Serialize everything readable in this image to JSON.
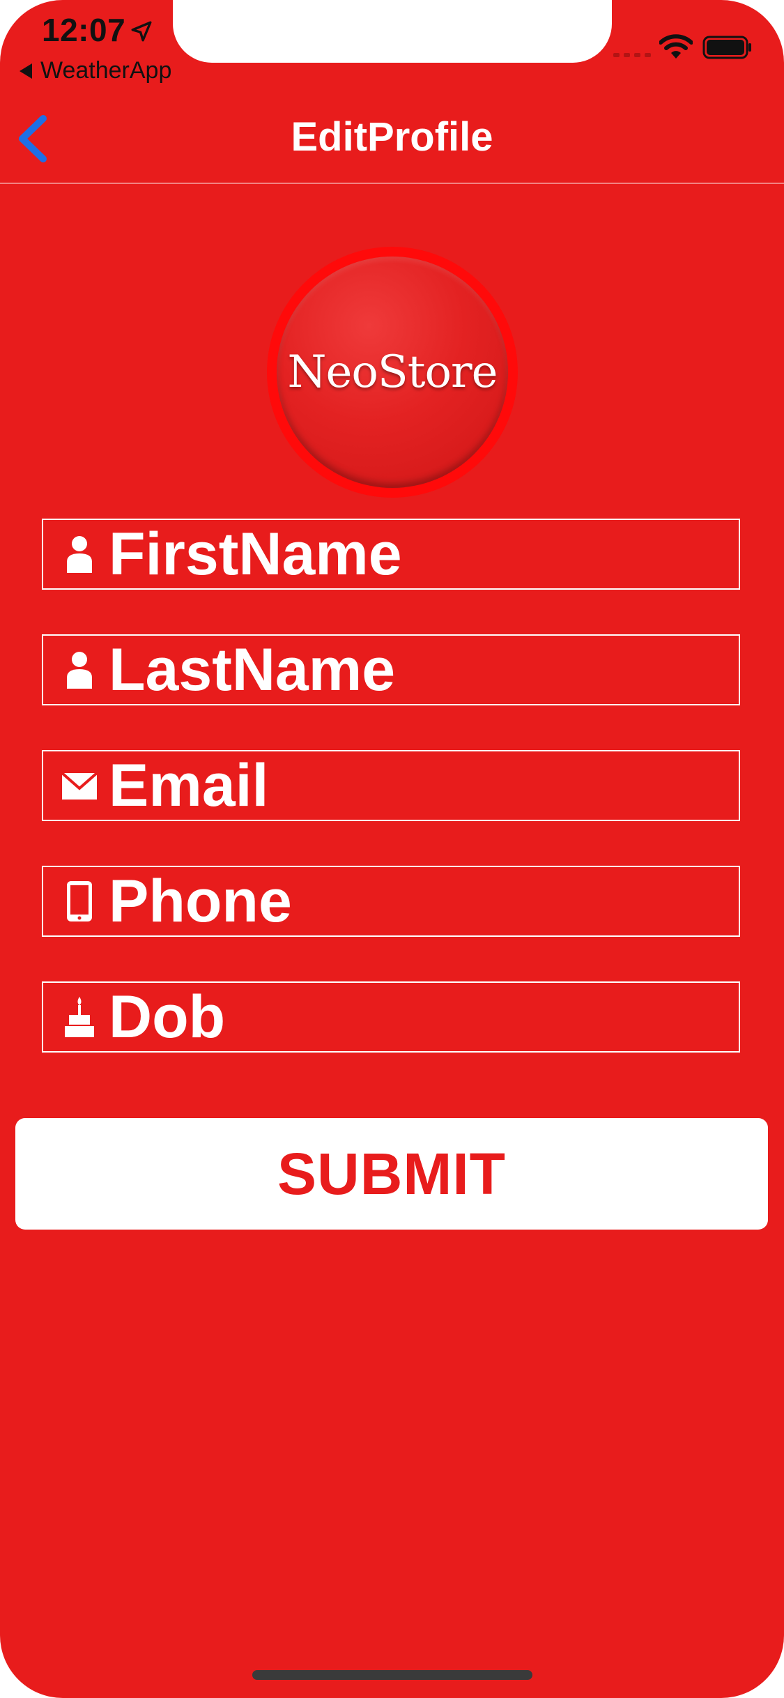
{
  "status_bar": {
    "time": "12:07",
    "back_app_label": "WeatherApp"
  },
  "nav": {
    "title": "EditProfile"
  },
  "logo": {
    "text": "NeoStore"
  },
  "form": {
    "fields": [
      {
        "label": "FirstName",
        "icon": "person-icon"
      },
      {
        "label": "LastName",
        "icon": "person-icon"
      },
      {
        "label": "Email",
        "icon": "envelope-icon"
      },
      {
        "label": "Phone",
        "icon": "phone-icon"
      },
      {
        "label": "Dob",
        "icon": "cake-icon"
      }
    ],
    "submit_label": "SUBMIT"
  },
  "colors": {
    "background": "#e81c1c",
    "accent_back": "#1e6fe6",
    "field_border": "#ffffff",
    "button_bg": "#ffffff",
    "button_text": "#e81c1c"
  }
}
